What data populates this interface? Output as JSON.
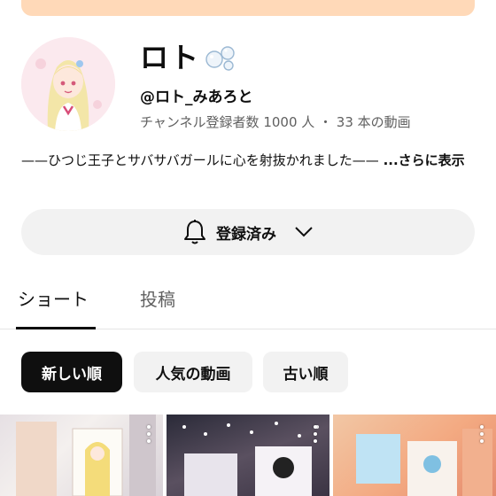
{
  "channel": {
    "name": "ロト",
    "handle": "@ロト_みあろと",
    "stats": "チャンネル登録者数 1000 人 ・ 33 本の動画",
    "description": "——ひつじ王子とサバサバガールに心を射抜かれました—— ",
    "description_more": "...さらに表示"
  },
  "subscribe_button": {
    "label": "登録済み",
    "bell_icon": "bell-icon",
    "dropdown_icon": "chevron-down-icon"
  },
  "tabs": [
    {
      "label": "ショート",
      "active": true
    },
    {
      "label": "投稿",
      "active": false
    }
  ],
  "filters": [
    {
      "label": "新しい順",
      "selected": true
    },
    {
      "label": "人気の動画",
      "selected": false
    },
    {
      "label": "古い順",
      "selected": false
    }
  ],
  "colors": {
    "banner": "#ffd9b8",
    "chip_selected_bg": "#0f0f0f",
    "chip_bg": "#f2f2f2",
    "secondary_text": "#606060"
  }
}
